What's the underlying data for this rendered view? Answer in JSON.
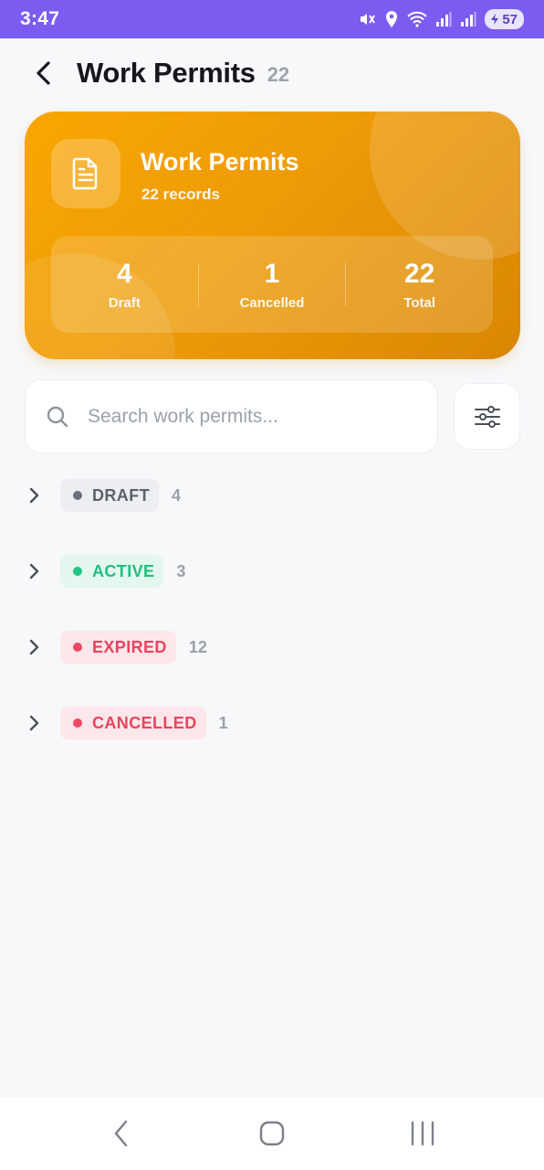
{
  "status_bar": {
    "time": "3:47",
    "battery": "57",
    "icons": [
      "mute-icon",
      "location-icon",
      "wifi-icon",
      "signal-icon",
      "signal-icon",
      "battery-icon"
    ]
  },
  "header": {
    "title": "Work Permits",
    "count": "22"
  },
  "hero": {
    "title": "Work Permits",
    "subtitle": "22 records",
    "icon": "document-icon",
    "stats": [
      {
        "value": "4",
        "label": "Draft"
      },
      {
        "value": "1",
        "label": "Cancelled"
      },
      {
        "value": "22",
        "label": "Total"
      }
    ]
  },
  "search": {
    "placeholder": "Search work permits...",
    "value": ""
  },
  "groups": [
    {
      "label": "DRAFT",
      "count": "4",
      "text_color": "#5c626d",
      "bg_color": "#eceef2",
      "dot_color": "#6b717c"
    },
    {
      "label": "ACTIVE",
      "count": "3",
      "text_color": "#1fbf7e",
      "bg_color": "#e3f7ee",
      "dot_color": "#22c483"
    },
    {
      "label": "EXPIRED",
      "count": "12",
      "text_color": "#e8445f",
      "bg_color": "#fde7ea",
      "dot_color": "#ee4864"
    },
    {
      "label": "CANCELLED",
      "count": "1",
      "text_color": "#e8445f",
      "bg_color": "#fde7ea",
      "dot_color": "#ee4864"
    }
  ],
  "colors": {
    "status_bar": "#7c5cf0",
    "hero_start": "#f9a602",
    "hero_end": "#d98604",
    "background": "#f7f8fa"
  },
  "nav": {
    "buttons": [
      "back-nav-icon",
      "home-nav-icon",
      "recents-nav-icon"
    ]
  }
}
